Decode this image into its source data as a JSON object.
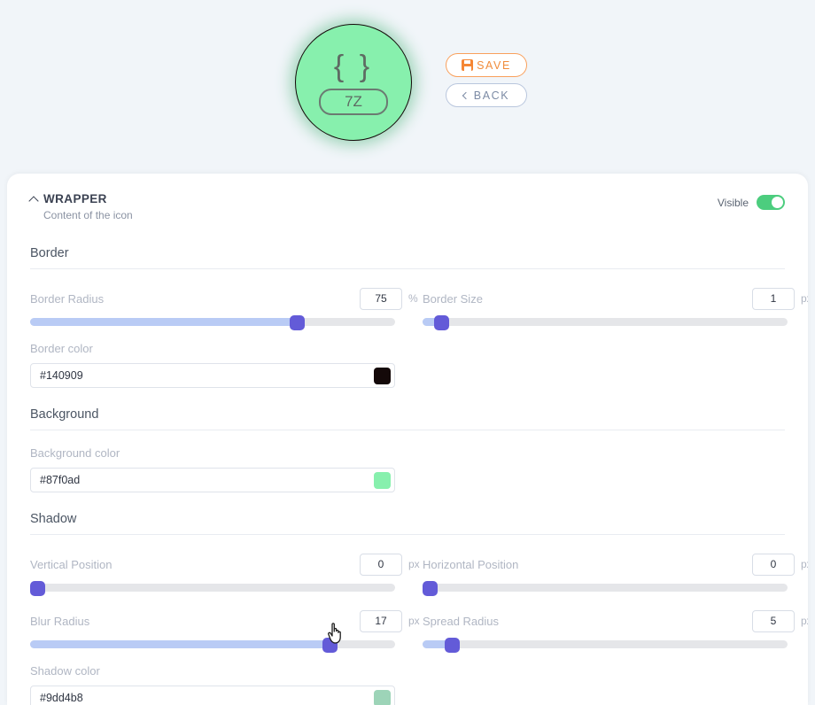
{
  "preview": {
    "icon_glyph": "{ }",
    "badge_text": "7Z",
    "background_color": "#87f0ad",
    "border_color": "#140909",
    "shadow_color": "#9dd4b8"
  },
  "actions": {
    "save_label": "SAVE",
    "back_label": "BACK",
    "save_accent": "#f58634",
    "back_accent": "#7c8ba5"
  },
  "panel": {
    "title": "WRAPPER",
    "subtitle": "Content of the icon",
    "visible_label": "Visible",
    "visible_on": true
  },
  "sections": {
    "border": {
      "title": "Border",
      "fields": [
        {
          "label": "Border Radius",
          "value": "75",
          "unit": "%",
          "percent": 73
        },
        {
          "label": "Border Size",
          "value": "1",
          "unit": "px",
          "percent": 5
        }
      ],
      "color": {
        "label": "Border color",
        "value": "#140909",
        "swatch": "#140909"
      }
    },
    "background": {
      "title": "Background",
      "color": {
        "label": "Background color",
        "value": "#87f0ad",
        "swatch": "#87f0ad"
      }
    },
    "shadow": {
      "title": "Shadow",
      "fields": [
        {
          "label": "Vertical Position",
          "value": "0",
          "unit": "px",
          "percent": 0
        },
        {
          "label": "Horizontal Position",
          "value": "0",
          "unit": "px",
          "percent": 0
        },
        {
          "label": "Blur Radius",
          "value": "17",
          "unit": "px",
          "percent": 82
        },
        {
          "label": "Spread Radius",
          "value": "5",
          "unit": "px",
          "percent": 8
        }
      ],
      "color": {
        "label": "Shadow color",
        "value": "#9dd4b8",
        "swatch": "#9dd4b8"
      }
    }
  }
}
